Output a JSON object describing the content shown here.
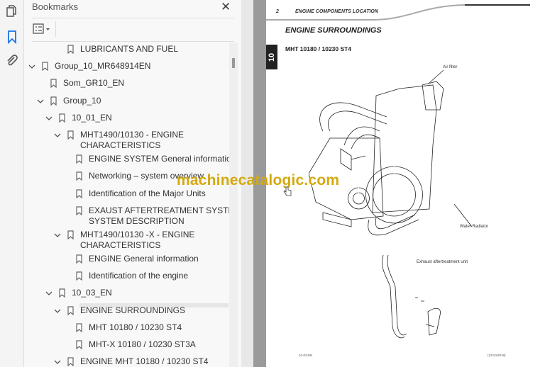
{
  "panel": {
    "title": "Bookmarks",
    "close": "✕"
  },
  "tree": [
    {
      "label": "LUBRICANTS AND FUEL",
      "level": 3,
      "expanded": null
    },
    {
      "label": "Group_10_MR648914EN",
      "level": 0,
      "expanded": true
    },
    {
      "label": "Som_GR10_EN",
      "level": 1,
      "expanded": null
    },
    {
      "label": "Group_10",
      "level": 1,
      "expanded": true
    },
    {
      "label": "10_01_EN",
      "level": 2,
      "expanded": true
    },
    {
      "label": "MHT1490/10130 - ENGINE",
      "label2": "CHARACTERISTICS",
      "level": 3,
      "expanded": true
    },
    {
      "label": "ENGINE SYSTEM General information",
      "level": 4,
      "expanded": null
    },
    {
      "label": "Networking – system overview",
      "level": 4,
      "expanded": null
    },
    {
      "label": "Identification of the Major Units",
      "level": 4,
      "expanded": null
    },
    {
      "label": "EXAUST AFTERTREATMENT SYSTEM -",
      "label2": "SYSTEM DESCRIPTION",
      "level": 4,
      "expanded": null
    },
    {
      "label": "MHT1490/10130 -X - ENGINE",
      "label2": "CHARACTERISTICS",
      "level": 3,
      "expanded": true
    },
    {
      "label": "ENGINE General information",
      "level": 4,
      "expanded": null
    },
    {
      "label": "Identification of the engine",
      "level": 4,
      "expanded": null
    },
    {
      "label": "10_03_EN",
      "level": 2,
      "expanded": true
    },
    {
      "label": "ENGINE SURROUNDINGS",
      "level": 3,
      "expanded": true,
      "selected": true
    },
    {
      "label": "MHT 10180 / 10230 ST4",
      "level": 4,
      "expanded": null
    },
    {
      "label": "MHT-X 10180 / 10230 ST3A",
      "level": 4,
      "expanded": null
    },
    {
      "label": "ENGINE MHT 10180 / 10230 ST4",
      "level": 3,
      "expanded": true
    }
  ],
  "document": {
    "page_number": "2",
    "section_header": "ENGINE COMPONENTS LOCATION",
    "title": "ENGINE SURROUNDINGS",
    "subtitle": "MHT 10180 / 10230 ST4",
    "chapter_tab": "10",
    "captions": {
      "air_filter": "Air filter",
      "water_radiator": "Water Radiator",
      "exhaust": "Exhaust aftertreatment unit"
    },
    "footer_left": "10-03-EN",
    "footer_right": "(22/10/2018)"
  },
  "watermark": "machinecatalogic.com",
  "colors": {
    "accent": "#1a73e8",
    "watermark": "#d4a90f"
  }
}
